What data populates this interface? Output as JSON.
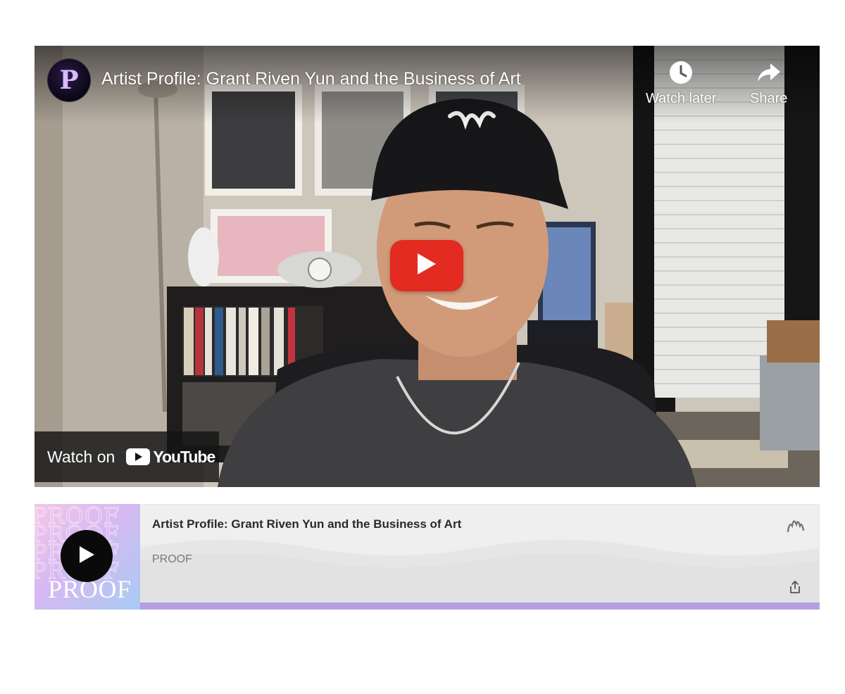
{
  "youtube_embed": {
    "channel_initial": "P",
    "title": "Artist Profile: Grant Riven Yun and the Business of Art",
    "watch_later_label": "Watch later",
    "share_label": "Share",
    "watch_on_label": "Watch on",
    "youtube_wordmark": "YouTube",
    "icons": {
      "watch_later": "clock-icon",
      "share": "share-arrow-icon",
      "play": "play-icon",
      "logo": "youtube-logo-icon"
    },
    "colors": {
      "play_button": "#e32b21"
    }
  },
  "podcast_player": {
    "title": "Artist Profile: Grant Riven Yun and the Business of Art",
    "channel": "PROOF",
    "cover_text": "PROOF",
    "progress": 1.0,
    "icons": {
      "play": "play-icon",
      "anchor": "anchor-logo-icon",
      "share": "share-icon"
    },
    "colors": {
      "progress": "#b79ee0",
      "cover_gradient": [
        "#f4c6e8",
        "#d6b8f2",
        "#a9cbf3"
      ]
    }
  }
}
